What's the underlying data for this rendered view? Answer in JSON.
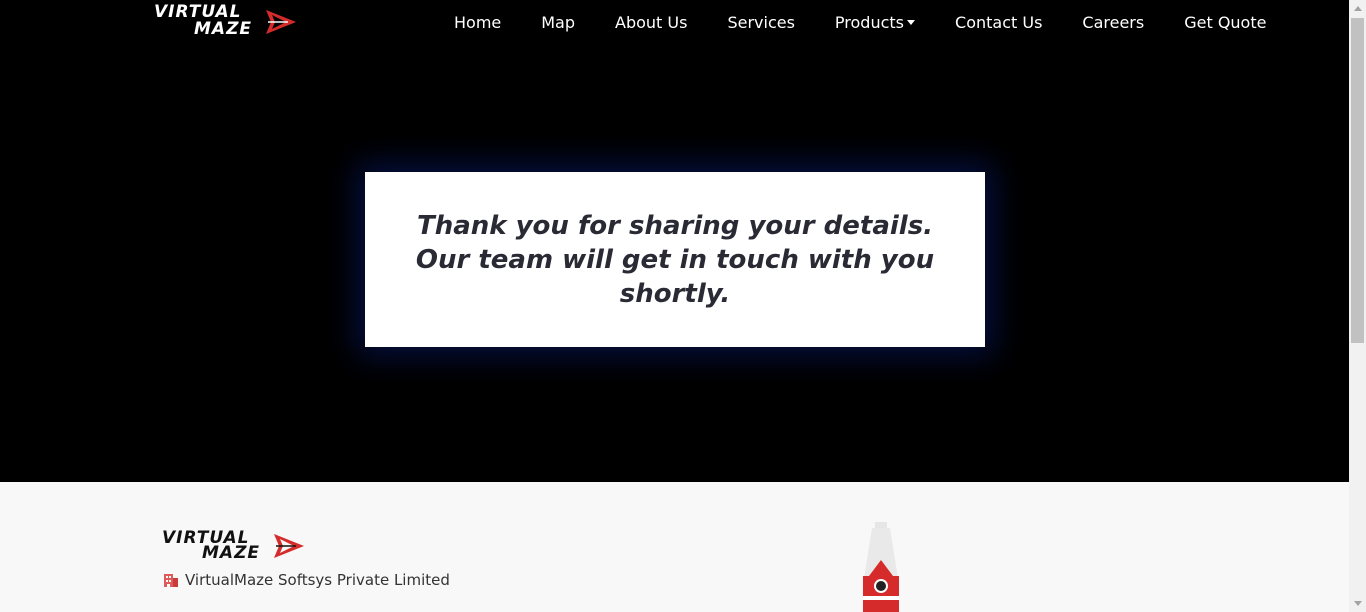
{
  "brand": {
    "logo_line1": "VIRTUAL",
    "logo_line2": "MAZE",
    "accent_color": "#d62b2b"
  },
  "nav": {
    "items": [
      {
        "label": "Home"
      },
      {
        "label": "Map"
      },
      {
        "label": "About Us"
      },
      {
        "label": "Services"
      },
      {
        "label": "Products",
        "dropdown": true
      },
      {
        "label": "Contact Us"
      },
      {
        "label": "Careers"
      },
      {
        "label": "Get Quote"
      }
    ]
  },
  "hero": {
    "message": "Thank you for sharing your details. Our team will get in touch with you shortly."
  },
  "footer": {
    "company_icon": "building-icon",
    "company_name": "VirtualMaze Softsys Private Limited",
    "illustration": "clock-tower-illustration"
  }
}
